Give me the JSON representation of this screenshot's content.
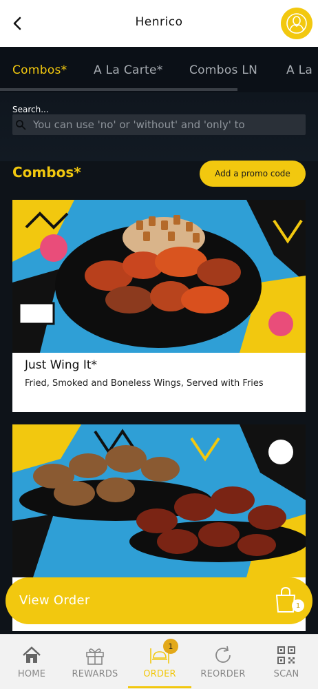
{
  "header": {
    "title": "Henrico",
    "back_icon": "chevron-left-icon",
    "account_icon": "user-icon"
  },
  "tabs": [
    {
      "label": "Combos*",
      "active": true
    },
    {
      "label": "A La Carte*",
      "active": false
    },
    {
      "label": "Combos LN",
      "active": false
    },
    {
      "label": "A La",
      "active": false
    }
  ],
  "search": {
    "label": "Search...",
    "placeholder": "You can use 'no' or 'without' and 'only' to",
    "value": ""
  },
  "section": {
    "title": "Combos*",
    "promo_button_label": "Add a promo code"
  },
  "menu_items": [
    {
      "name": "Just Wing It*",
      "description": "Fried, Smoked and Boneless Wings, Served with Fries"
    },
    {
      "name": "",
      "description": ""
    }
  ],
  "view_order": {
    "label": "View Order",
    "item_count": "1"
  },
  "bottom_nav": {
    "items": [
      {
        "label": "HOME",
        "icon": "home-icon",
        "active": false
      },
      {
        "label": "REWARDS",
        "icon": "gift-icon",
        "active": false
      },
      {
        "label": "ORDER",
        "icon": "order-icon",
        "active": true,
        "badge": "1"
      },
      {
        "label": "REORDER",
        "icon": "refresh-icon",
        "active": false
      },
      {
        "label": "SCAN",
        "icon": "qr-code-icon",
        "active": false
      }
    ]
  },
  "colors": {
    "accent": "#f2c80f",
    "dark_bg": "#0e1319",
    "inactive_text": "#a7acb2"
  }
}
